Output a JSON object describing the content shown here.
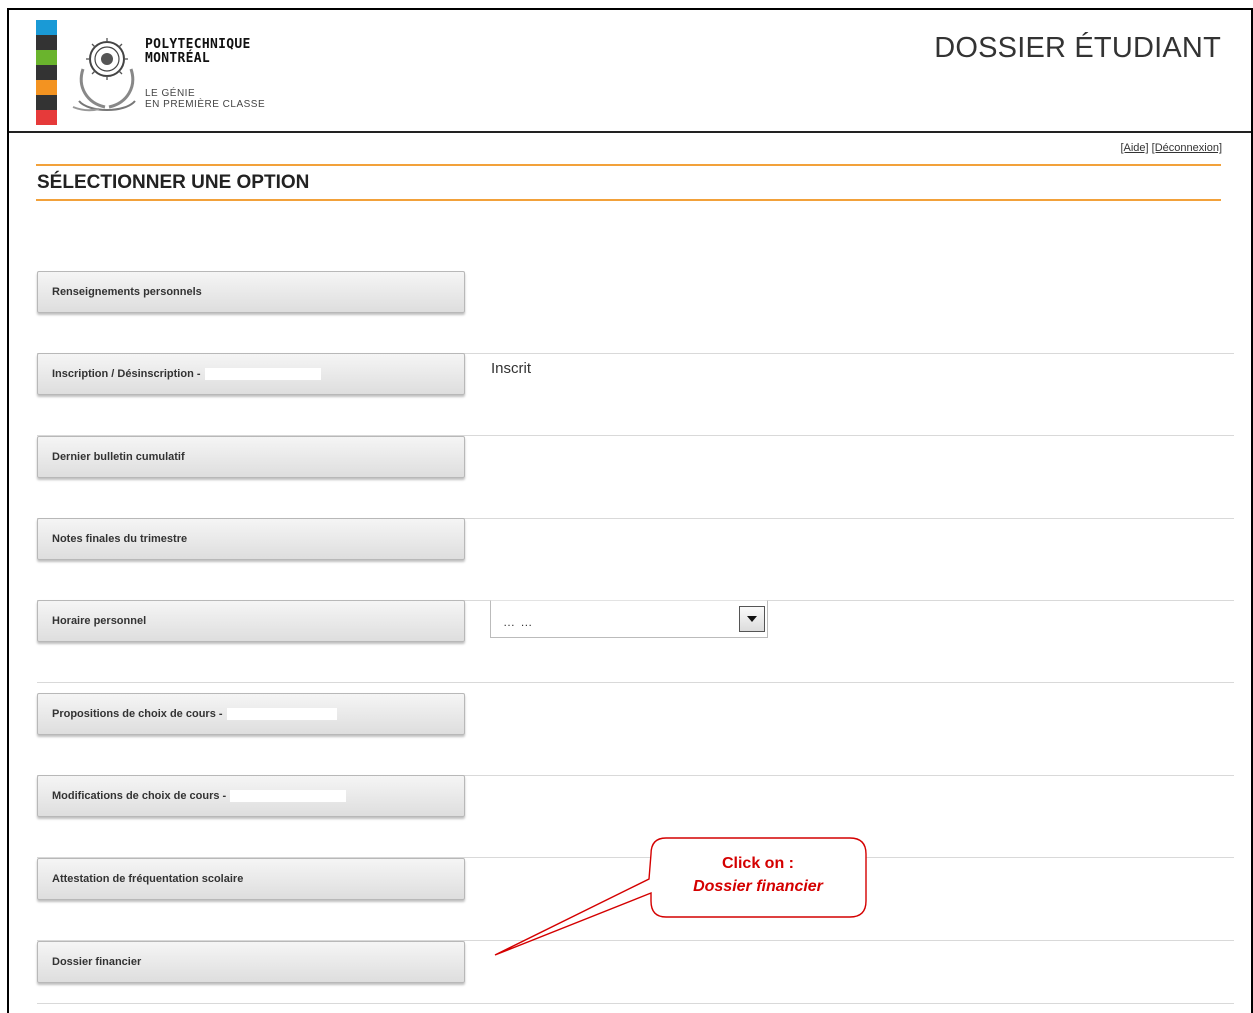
{
  "header": {
    "brand_line1": "POLYTECHNIQUE",
    "brand_line2": "MONTRÉAL",
    "tagline_line1": "LE GÉNIE",
    "tagline_line2": "EN PREMIÈRE CLASSE",
    "app_title": "DOSSIER ÉTUDIANT",
    "color_bar": [
      "#1a9ad6",
      "#333333",
      "#6ab42d",
      "#333333",
      "#f39321",
      "#333333",
      "#e63a3a"
    ]
  },
  "top_links": {
    "help": "[Aide]",
    "logout": "[Déconnexion]"
  },
  "section": {
    "title": "SÉLECTIONNER UNE OPTION",
    "accent_color": "#f2a13a"
  },
  "options": [
    {
      "label": "Renseignements personnels"
    },
    {
      "label": "Inscription / Désinscription -",
      "status": "Inscrit"
    },
    {
      "label": "Dernier bulletin cumulatif"
    },
    {
      "label": "Notes finales du trimestre"
    },
    {
      "label": "Horaire personnel"
    },
    {
      "label": "Propositions de choix de cours -"
    },
    {
      "label": "Modifications de choix de cours -"
    },
    {
      "label": "Attestation de fréquentation scolaire"
    },
    {
      "label": "Dossier financier"
    }
  ],
  "schedule_select": {
    "value": "… …",
    "icon": "chevron-down-icon"
  },
  "callout": {
    "line1": "Click on :",
    "line2": "Dossier financier",
    "color": "#d40000"
  }
}
